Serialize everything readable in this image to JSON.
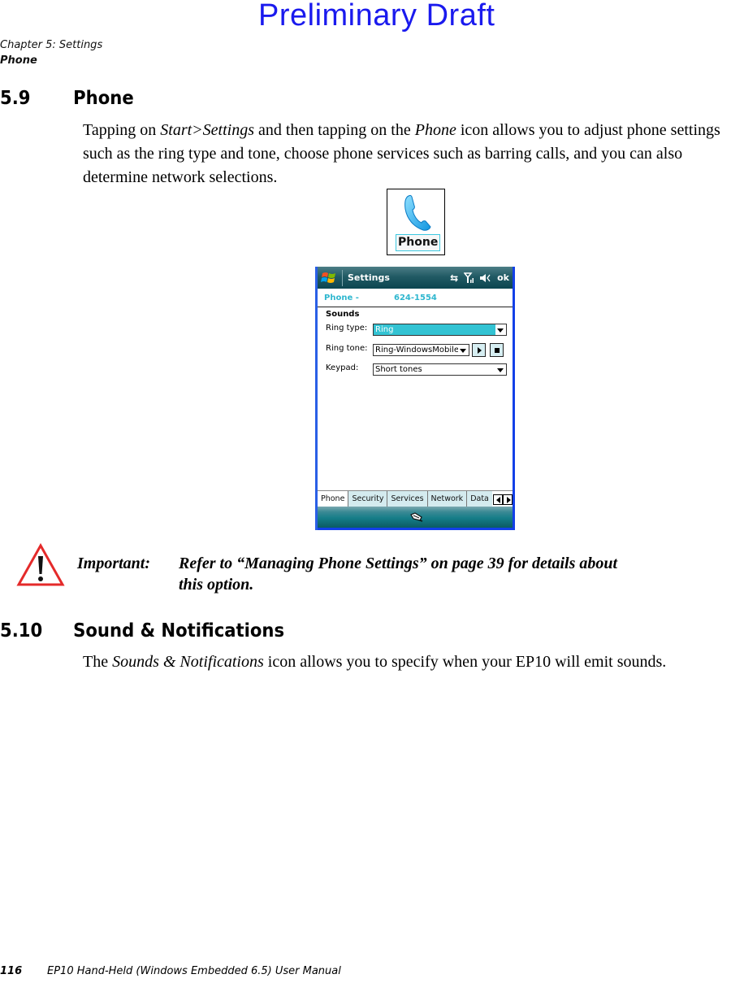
{
  "watermark": "Preliminary Draft",
  "running_header": {
    "chapter": "Chapter 5:  Settings",
    "section": "Phone"
  },
  "section_phone": {
    "number": "5.9",
    "title": "Phone",
    "paragraph": {
      "t1": "Tapping on ",
      "i1": "Start>Settings",
      "t2": " and then tapping on the ",
      "i2": "Phone",
      "t3": " icon allows you to adjust phone settings such as the ring type and tone, choose phone services such as barring calls, and you can also determine network selections."
    }
  },
  "phone_icon": {
    "icon": "phone-handset-icon",
    "label": "Phone"
  },
  "device_screen": {
    "titlebar": {
      "start_icon": "windows-flag-icon",
      "title": "Settings",
      "status_icons": [
        "connectivity-icon",
        "signal-icon",
        "speaker-icon"
      ],
      "ok_label": "ok"
    },
    "phone_line": {
      "label": "Phone -",
      "number": "624-1554"
    },
    "section_label": "Sounds",
    "fields": [
      {
        "label": "Ring type:",
        "value": "Ring"
      },
      {
        "label": "Ring tone:",
        "value": "Ring-WindowsMobile"
      },
      {
        "label": "Keypad:",
        "value": "Short tones"
      }
    ],
    "tabs": [
      "Phone",
      "Security",
      "Services",
      "Network",
      "Data"
    ],
    "active_tab": "Phone",
    "menubar_icon": "input-panel-icon"
  },
  "important_note": {
    "label": "Important:",
    "text_line1": "Refer to “Managing Phone Settings” on page 39 for details about",
    "text_line2": "this option."
  },
  "section_sound": {
    "number": "5.10",
    "title": "Sound & Notifications",
    "paragraph": {
      "t1": "The ",
      "i1": "Sounds & Notifications",
      "t2": " icon allows you to specify when your EP10 will emit sounds."
    }
  },
  "footer": {
    "page_number": "116",
    "manual_title": "EP10 Hand-Held (Windows Embedded 6.5) User Manual"
  },
  "colors": {
    "watermark": "#1a1aee",
    "accent_cyan": "#33c3d3",
    "device_border": "#1340e8",
    "warning_red": "#e42a2a"
  }
}
